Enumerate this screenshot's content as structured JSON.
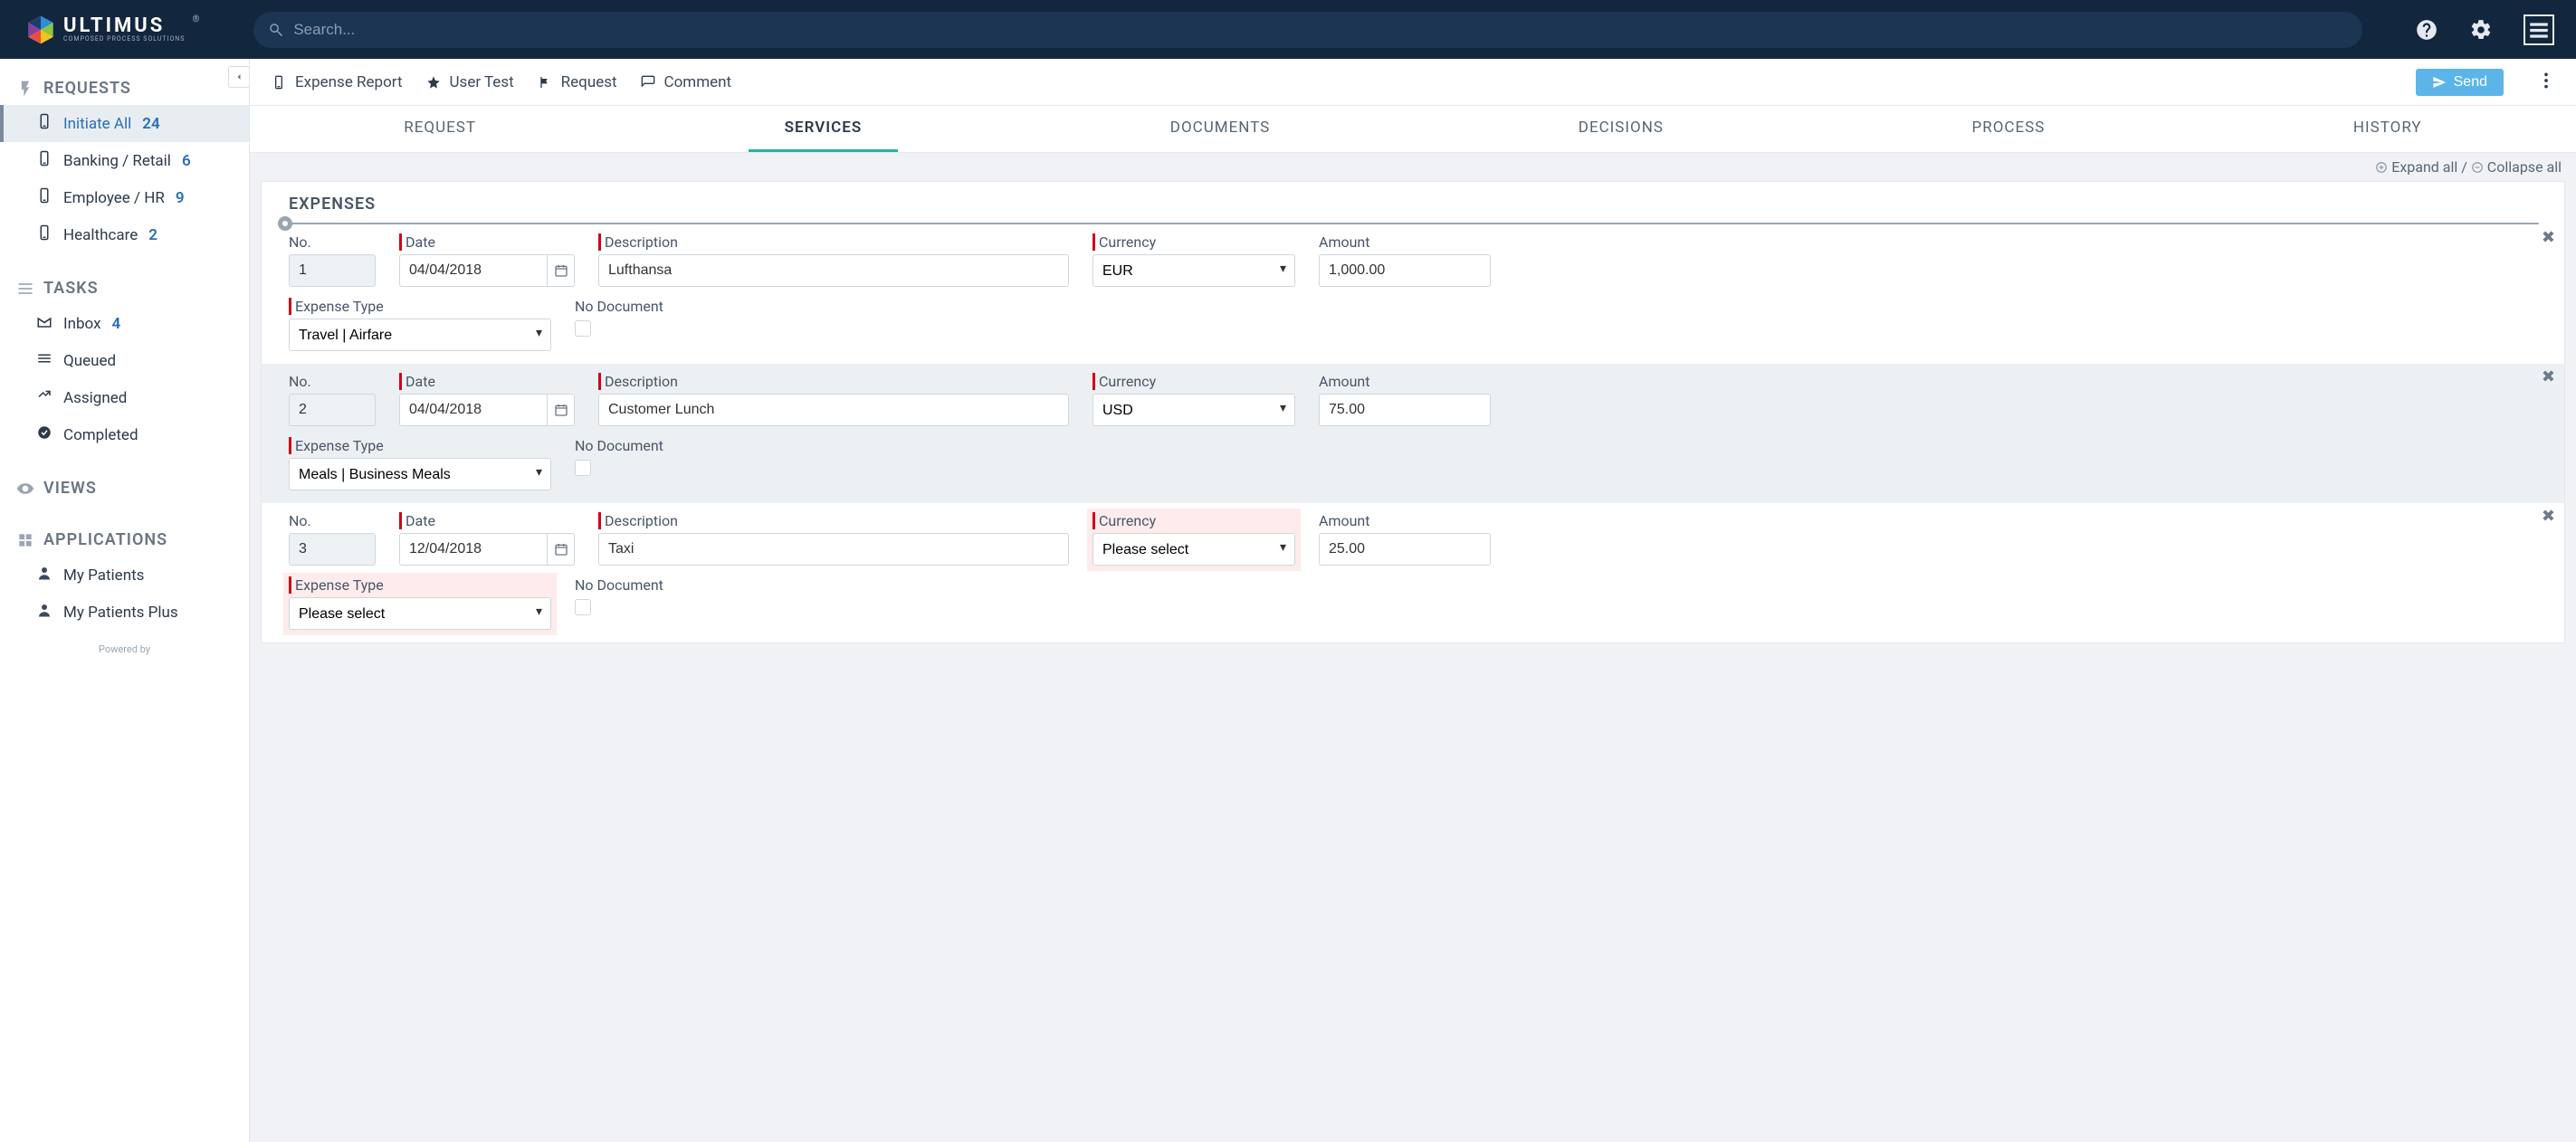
{
  "brand": {
    "name": "ULTIMUS",
    "tagline": "COMPOSED PROCESS SOLUTIONS"
  },
  "search": {
    "placeholder": "Search..."
  },
  "sidebar": {
    "requests_header": "REQUESTS",
    "requests": [
      {
        "label": "Initiate All",
        "count": "24",
        "active": true
      },
      {
        "label": "Banking / Retail",
        "count": "6",
        "active": false
      },
      {
        "label": "Employee / HR",
        "count": "9",
        "active": false
      },
      {
        "label": "Healthcare",
        "count": "2",
        "active": false
      }
    ],
    "tasks_header": "TASKS",
    "tasks": [
      {
        "label": "Inbox",
        "count": "4"
      },
      {
        "label": "Queued",
        "count": ""
      },
      {
        "label": "Assigned",
        "count": ""
      },
      {
        "label": "Completed",
        "count": ""
      }
    ],
    "views_header": "VIEWS",
    "apps_header": "APPLICATIONS",
    "apps": [
      {
        "label": "My Patients"
      },
      {
        "label": "My Patients Plus"
      }
    ],
    "powered": "Powered by"
  },
  "crumbs": {
    "title": "Expense Report",
    "user": "User Test",
    "activity": "Request",
    "comment": "Comment"
  },
  "send_label": "Send",
  "tabs": {
    "items": [
      "REQUEST",
      "SERVICES",
      "DOCUMENTS",
      "DECISIONS",
      "PROCESS",
      "HISTORY"
    ],
    "active": 1
  },
  "expand": "Expand all",
  "sep": " / ",
  "collapse": "Collapse all",
  "panel_title": "EXPENSES",
  "labels": {
    "no": "No.",
    "date": "Date",
    "description": "Description",
    "currency": "Currency",
    "amount": "Amount",
    "expense_type": "Expense Type",
    "no_document": "No Document"
  },
  "rows": [
    {
      "no": "1",
      "date": "04/04/2018",
      "description": "Lufthansa",
      "currency": "EUR",
      "amount": "1,000.00",
      "expense_type": "Travel | Airfare",
      "no_doc": false,
      "currency_err": false,
      "type_err": false,
      "alt": false
    },
    {
      "no": "2",
      "date": "04/04/2018",
      "description": "Customer Lunch",
      "currency": "USD",
      "amount": "75.00",
      "expense_type": "Meals | Business Meals",
      "no_doc": false,
      "currency_err": false,
      "type_err": false,
      "alt": true
    },
    {
      "no": "3",
      "date": "12/04/2018",
      "description": "Taxi",
      "currency": "Please select",
      "amount": "25.00",
      "expense_type": "Please select",
      "no_doc": false,
      "currency_err": true,
      "type_err": true,
      "alt": false
    }
  ]
}
